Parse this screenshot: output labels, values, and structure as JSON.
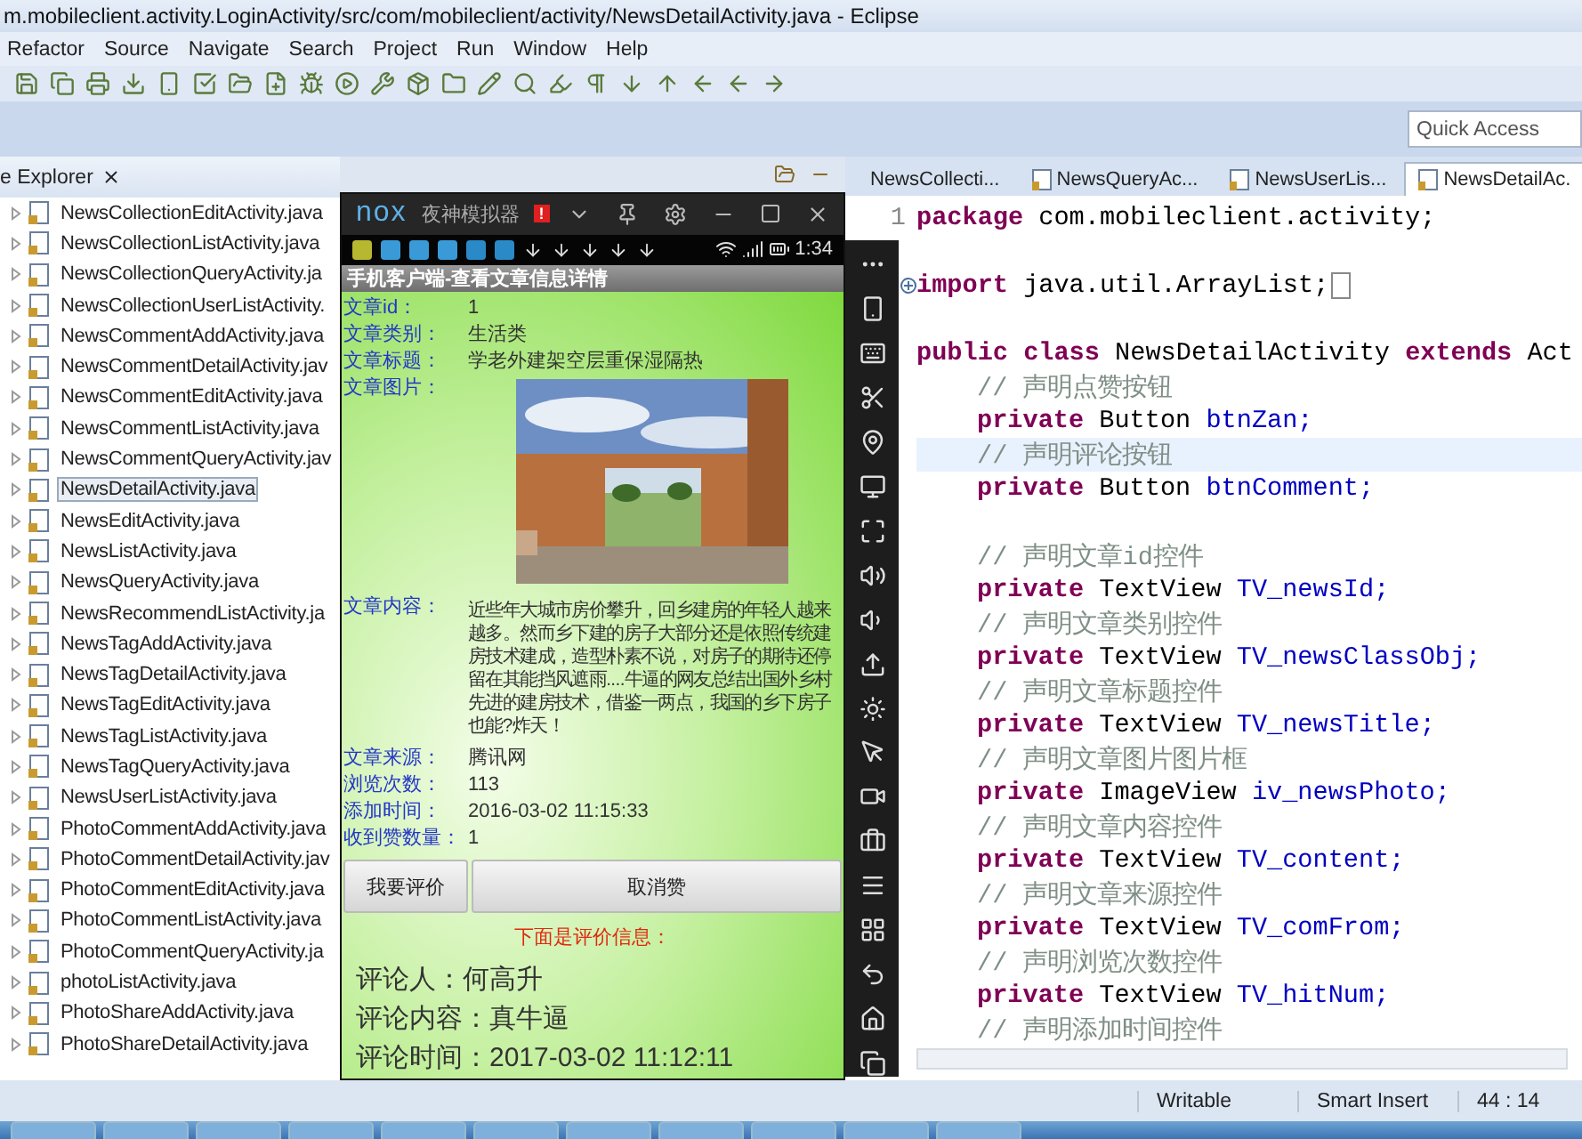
{
  "window": {
    "title": "m.mobileclient.activity.LoginActivity/src/com/mobileclient/activity/NewsDetailActivity.java - Eclipse"
  },
  "menu": [
    "Refactor",
    "Source",
    "Navigate",
    "Search",
    "Project",
    "Run",
    "Window",
    "Help"
  ],
  "quick_access": {
    "placeholder": "Quick Access"
  },
  "explorer": {
    "title": "e Explorer",
    "items": [
      {
        "label": "NewsCollectionEditActivity.java",
        "selected": false
      },
      {
        "label": "NewsCollectionListActivity.java",
        "selected": false
      },
      {
        "label": "NewsCollectionQueryActivity.ja",
        "selected": false
      },
      {
        "label": "NewsCollectionUserListActivity.",
        "selected": false
      },
      {
        "label": "NewsCommentAddActivity.java",
        "selected": false
      },
      {
        "label": "NewsCommentDetailActivity.jav",
        "selected": false
      },
      {
        "label": "NewsCommentEditActivity.java",
        "selected": false
      },
      {
        "label": "NewsCommentListActivity.java",
        "selected": false
      },
      {
        "label": "NewsCommentQueryActivity.jav",
        "selected": false
      },
      {
        "label": "NewsDetailActivity.java",
        "selected": true
      },
      {
        "label": "NewsEditActivity.java",
        "selected": false
      },
      {
        "label": "NewsListActivity.java",
        "selected": false
      },
      {
        "label": "NewsQueryActivity.java",
        "selected": false
      },
      {
        "label": "NewsRecommendListActivity.ja",
        "selected": false
      },
      {
        "label": "NewsTagAddActivity.java",
        "selected": false
      },
      {
        "label": "NewsTagDetailActivity.java",
        "selected": false
      },
      {
        "label": "NewsTagEditActivity.java",
        "selected": false
      },
      {
        "label": "NewsTagListActivity.java",
        "selected": false
      },
      {
        "label": "NewsTagQueryActivity.java",
        "selected": false
      },
      {
        "label": "NewsUserListActivity.java",
        "selected": false
      },
      {
        "label": "PhotoCommentAddActivity.java",
        "selected": false
      },
      {
        "label": "PhotoCommentDetailActivity.jav",
        "selected": false
      },
      {
        "label": "PhotoCommentEditActivity.java",
        "selected": false
      },
      {
        "label": "PhotoCommentListActivity.java",
        "selected": false
      },
      {
        "label": "PhotoCommentQueryActivity.ja",
        "selected": false
      },
      {
        "label": "photoListActivity.java",
        "selected": false
      },
      {
        "label": "PhotoShareAddActivity.java",
        "selected": false
      },
      {
        "label": "PhotoShareDetailActivity.java",
        "selected": false
      }
    ]
  },
  "emulator": {
    "brand": "nox",
    "title": "夜神模拟器",
    "badge": "!",
    "time": "1:34",
    "app_title": "手机客户端-查看文章信息详情",
    "fields": [
      {
        "kind": "text",
        "label": "文章id：",
        "value": "1"
      },
      {
        "kind": "text",
        "label": "文章类别：",
        "value": "生活类"
      },
      {
        "kind": "text",
        "label": "文章标题：",
        "value": "学老外建架空层重保湿隔热"
      },
      {
        "kind": "picture",
        "label": "文章图片："
      },
      {
        "kind": "text",
        "label": "文章内容：",
        "value": "近些年大城市房价攀升，回乡建房的年轻人越来越多。然而乡下建的房子大部分还是依照传统建房技术建成，造型朴素不说，对房子的期待还停留在其能挡风遮雨....牛逼的网友总结出国外乡村先进的建房技术，借鉴一两点，我国的乡下房子也能?炸天！"
      },
      {
        "kind": "text",
        "label": "文章来源：",
        "value": "腾讯网"
      },
      {
        "kind": "text",
        "label": "浏览次数：",
        "value": "113"
      },
      {
        "kind": "text",
        "label": "添加时间：",
        "value": "2016-03-02 11:15:33"
      },
      {
        "kind": "text",
        "label": "收到赞数量：",
        "value": "1"
      }
    ],
    "buttons": [
      "我要评价",
      "取消赞"
    ],
    "notice": "下面是评价信息：",
    "comments": [
      "评论人：何高升",
      "评论内容：真牛逼",
      "评论时间：2017-03-02 11:12:11"
    ]
  },
  "editor": {
    "tabs": [
      {
        "label": "NewsCollecti...",
        "selected": false
      },
      {
        "label": "NewsQueryAc...",
        "selected": false
      },
      {
        "label": "NewsUserLis...",
        "selected": false
      },
      {
        "label": "NewsDetailAc.",
        "selected": true
      }
    ],
    "lines": [
      {
        "kind": "code",
        "number": "1",
        "indent": false,
        "current": false,
        "folded": false,
        "tokens": [
          {
            "kind": "keyword",
            "text": "package"
          },
          {
            "kind": "plain",
            "text": "com.mobileclient.activity;"
          }
        ]
      },
      {
        "kind": "blank"
      },
      {
        "kind": "code",
        "indent": false,
        "current": false,
        "folded": true,
        "tokens": [
          {
            "kind": "keyword",
            "text": "import"
          },
          {
            "kind": "plain",
            "text": "java.util.ArrayList;"
          }
        ]
      },
      {
        "kind": "blank"
      },
      {
        "kind": "code",
        "indent": false,
        "current": false,
        "folded": false,
        "tokens": [
          {
            "kind": "keyword",
            "text": "public"
          },
          {
            "kind": "keyword",
            "text": "class"
          },
          {
            "kind": "plain",
            "text": "NewsDetailActivity"
          },
          {
            "kind": "keyword",
            "text": "extends"
          },
          {
            "kind": "plain",
            "text": "Act"
          }
        ]
      },
      {
        "kind": "code",
        "indent": true,
        "current": false,
        "folded": false,
        "tokens": [
          {
            "kind": "comment",
            "text": "// 声明点赞按钮"
          }
        ]
      },
      {
        "kind": "code",
        "indent": true,
        "current": false,
        "folded": false,
        "tokens": [
          {
            "kind": "keyword",
            "text": "private"
          },
          {
            "kind": "plain",
            "text": "Button"
          },
          {
            "kind": "field",
            "text": "btnZan;"
          }
        ]
      },
      {
        "kind": "code",
        "indent": true,
        "current": true,
        "folded": false,
        "tokens": [
          {
            "kind": "comment",
            "text": "// 声明评论按钮"
          }
        ]
      },
      {
        "kind": "code",
        "indent": true,
        "current": false,
        "folded": false,
        "tokens": [
          {
            "kind": "keyword",
            "text": "private"
          },
          {
            "kind": "plain",
            "text": "Button"
          },
          {
            "kind": "field",
            "text": "btnComment;"
          }
        ]
      },
      {
        "kind": "blank"
      },
      {
        "kind": "code",
        "indent": true,
        "current": false,
        "folded": false,
        "tokens": [
          {
            "kind": "comment",
            "text": "// 声明文章id控件"
          }
        ]
      },
      {
        "kind": "code",
        "indent": true,
        "current": false,
        "folded": false,
        "tokens": [
          {
            "kind": "keyword",
            "text": "private"
          },
          {
            "kind": "plain",
            "text": "TextView"
          },
          {
            "kind": "field",
            "text": "TV_newsId;"
          }
        ]
      },
      {
        "kind": "code",
        "indent": true,
        "current": false,
        "folded": false,
        "tokens": [
          {
            "kind": "comment",
            "text": "// 声明文章类别控件"
          }
        ]
      },
      {
        "kind": "code",
        "indent": true,
        "current": false,
        "folded": false,
        "tokens": [
          {
            "kind": "keyword",
            "text": "private"
          },
          {
            "kind": "plain",
            "text": "TextView"
          },
          {
            "kind": "field",
            "text": "TV_newsClassObj;"
          }
        ]
      },
      {
        "kind": "code",
        "indent": true,
        "current": false,
        "folded": false,
        "tokens": [
          {
            "kind": "comment",
            "text": "// 声明文章标题控件"
          }
        ]
      },
      {
        "kind": "code",
        "indent": true,
        "current": false,
        "folded": false,
        "tokens": [
          {
            "kind": "keyword",
            "text": "private"
          },
          {
            "kind": "plain",
            "text": "TextView"
          },
          {
            "kind": "field",
            "text": "TV_newsTitle;"
          }
        ]
      },
      {
        "kind": "code",
        "indent": true,
        "current": false,
        "folded": false,
        "tokens": [
          {
            "kind": "comment",
            "text": "// 声明文章图片图片框"
          }
        ]
      },
      {
        "kind": "code",
        "indent": true,
        "current": false,
        "folded": false,
        "tokens": [
          {
            "kind": "keyword",
            "text": "private"
          },
          {
            "kind": "plain",
            "text": "ImageView"
          },
          {
            "kind": "field",
            "text": "iv_newsPhoto;"
          }
        ]
      },
      {
        "kind": "code",
        "indent": true,
        "current": false,
        "folded": false,
        "tokens": [
          {
            "kind": "comment",
            "text": "// 声明文章内容控件"
          }
        ]
      },
      {
        "kind": "code",
        "indent": true,
        "current": false,
        "folded": false,
        "tokens": [
          {
            "kind": "keyword",
            "text": "private"
          },
          {
            "kind": "plain",
            "text": "TextView"
          },
          {
            "kind": "field",
            "text": "TV_content;"
          }
        ]
      },
      {
        "kind": "code",
        "indent": true,
        "current": false,
        "folded": false,
        "tokens": [
          {
            "kind": "comment",
            "text": "// 声明文章来源控件"
          }
        ]
      },
      {
        "kind": "code",
        "indent": true,
        "current": false,
        "folded": false,
        "tokens": [
          {
            "kind": "keyword",
            "text": "private"
          },
          {
            "kind": "plain",
            "text": "TextView"
          },
          {
            "kind": "field",
            "text": "TV_comFrom;"
          }
        ]
      },
      {
        "kind": "code",
        "indent": true,
        "current": false,
        "folded": false,
        "tokens": [
          {
            "kind": "comment",
            "text": "// 声明浏览次数控件"
          }
        ]
      },
      {
        "kind": "code",
        "indent": true,
        "current": false,
        "folded": false,
        "tokens": [
          {
            "kind": "keyword",
            "text": "private"
          },
          {
            "kind": "plain",
            "text": "TextView"
          },
          {
            "kind": "field",
            "text": "TV_hitNum;"
          }
        ]
      },
      {
        "kind": "code",
        "indent": true,
        "current": false,
        "folded": false,
        "tokens": [
          {
            "kind": "comment",
            "text": "// 声明添加时间控件"
          }
        ]
      }
    ]
  },
  "status_bar": [
    "Writable",
    "Smart Insert",
    "44 : 14"
  ]
}
